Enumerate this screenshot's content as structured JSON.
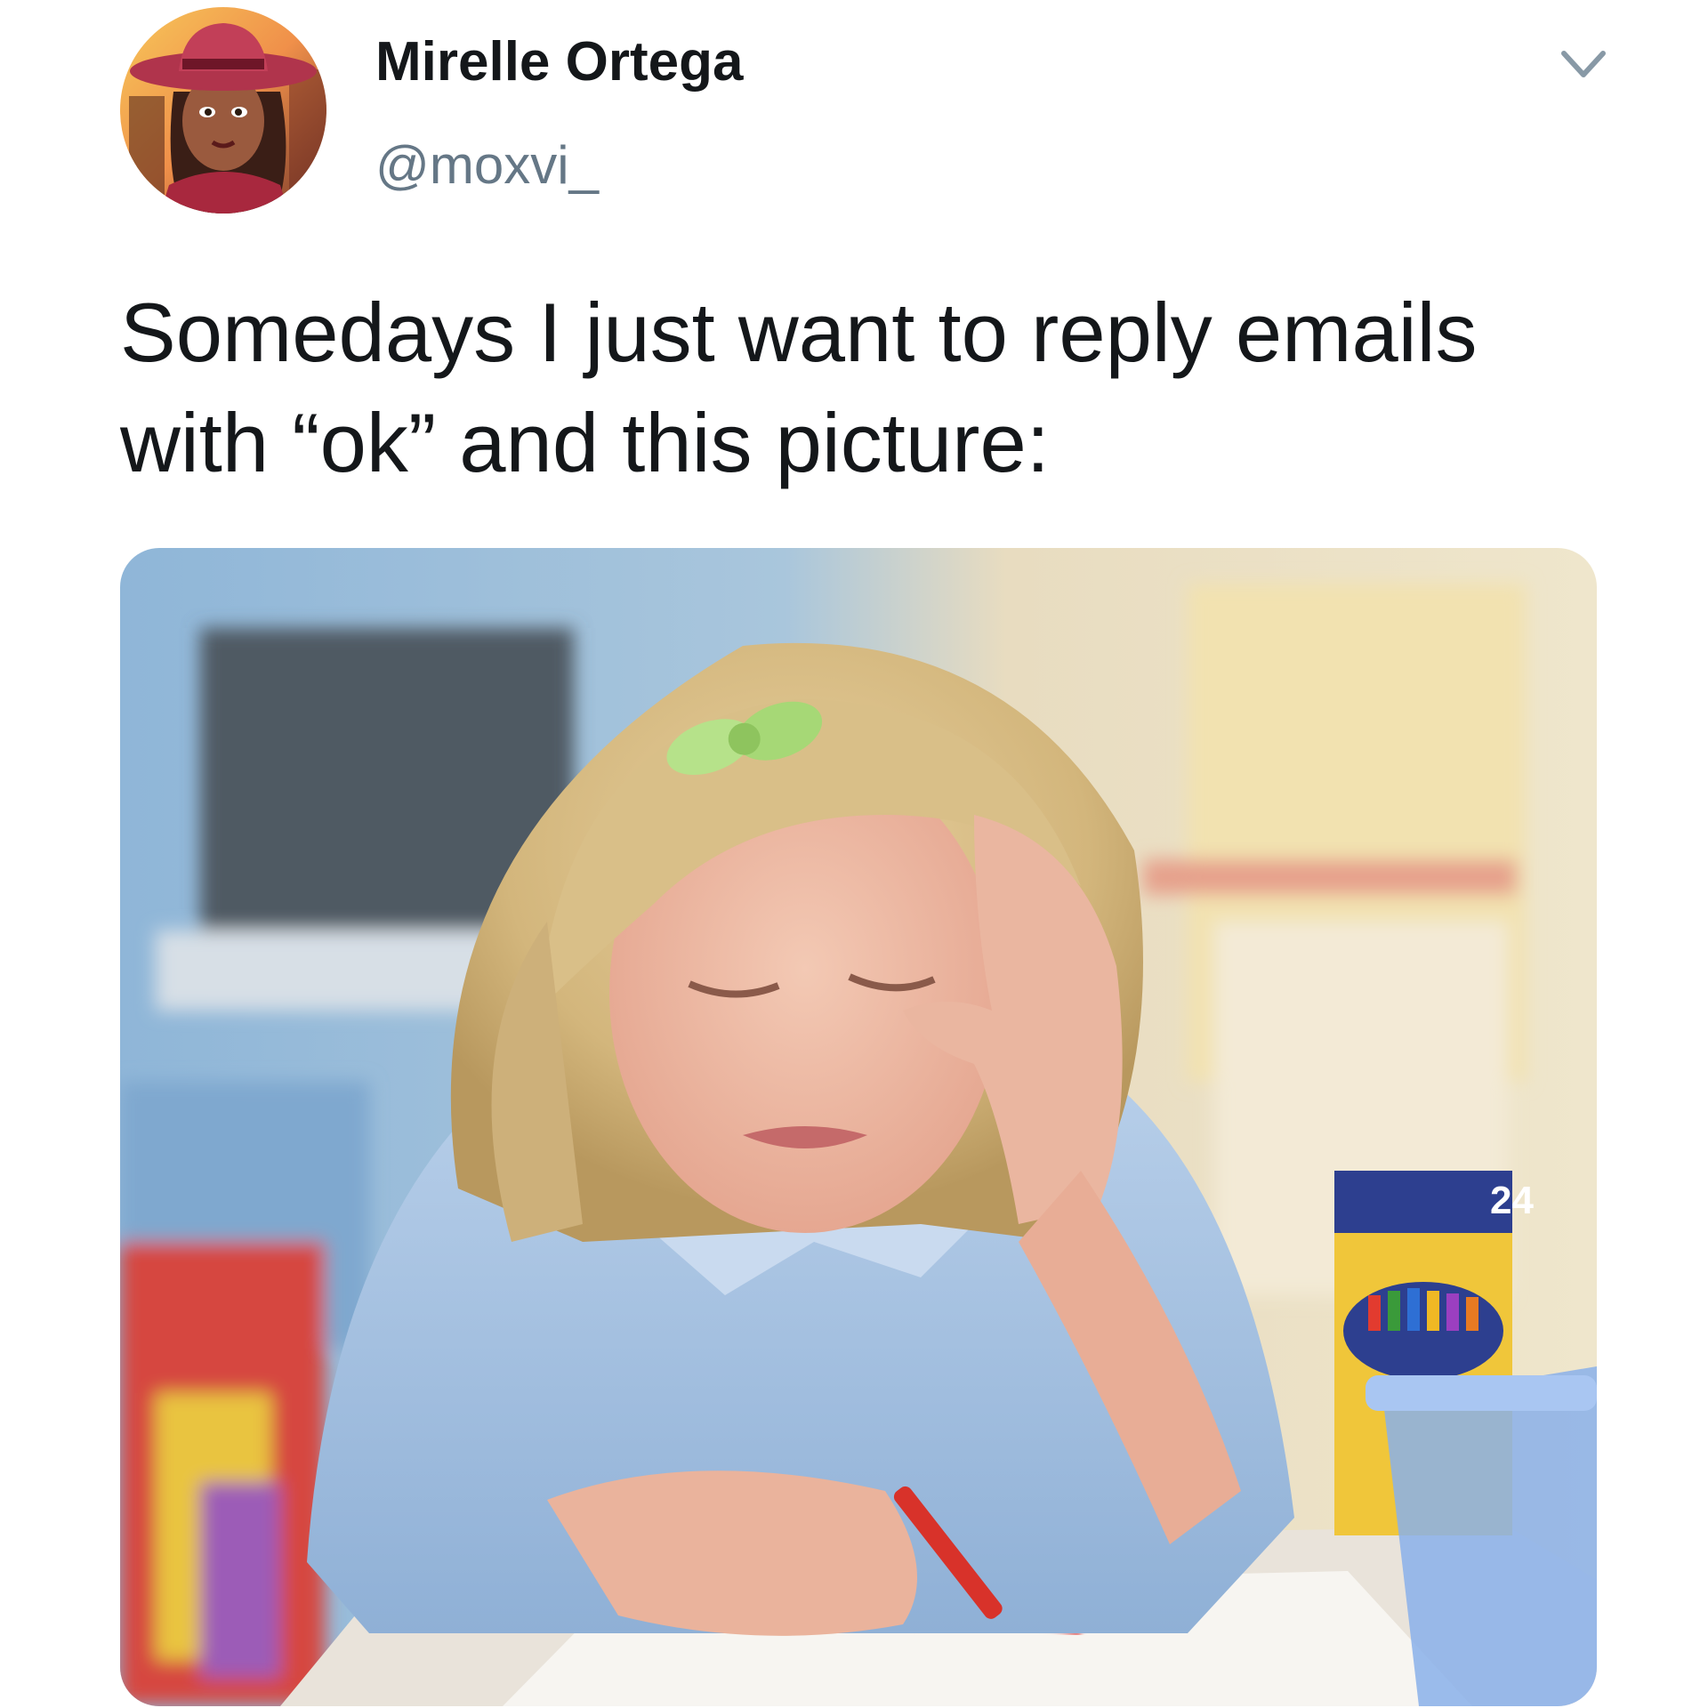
{
  "tweet": {
    "author": {
      "display_name": "Mirelle Ortega",
      "handle": "@moxvi_",
      "avatar_icon": "cartoon-avatar-red-hat"
    },
    "menu_icon": "chevron-down-icon",
    "text_lines": [
      "Somedays I just want to reply emails",
      "with “ok” and this picture:"
    ],
    "media": {
      "type": "photo",
      "crayon_box_label": "24"
    }
  },
  "colors": {
    "name": "#14171a",
    "handle": "#657786",
    "chevron": "#8899a6",
    "avatar_hat": "#b0344c"
  }
}
